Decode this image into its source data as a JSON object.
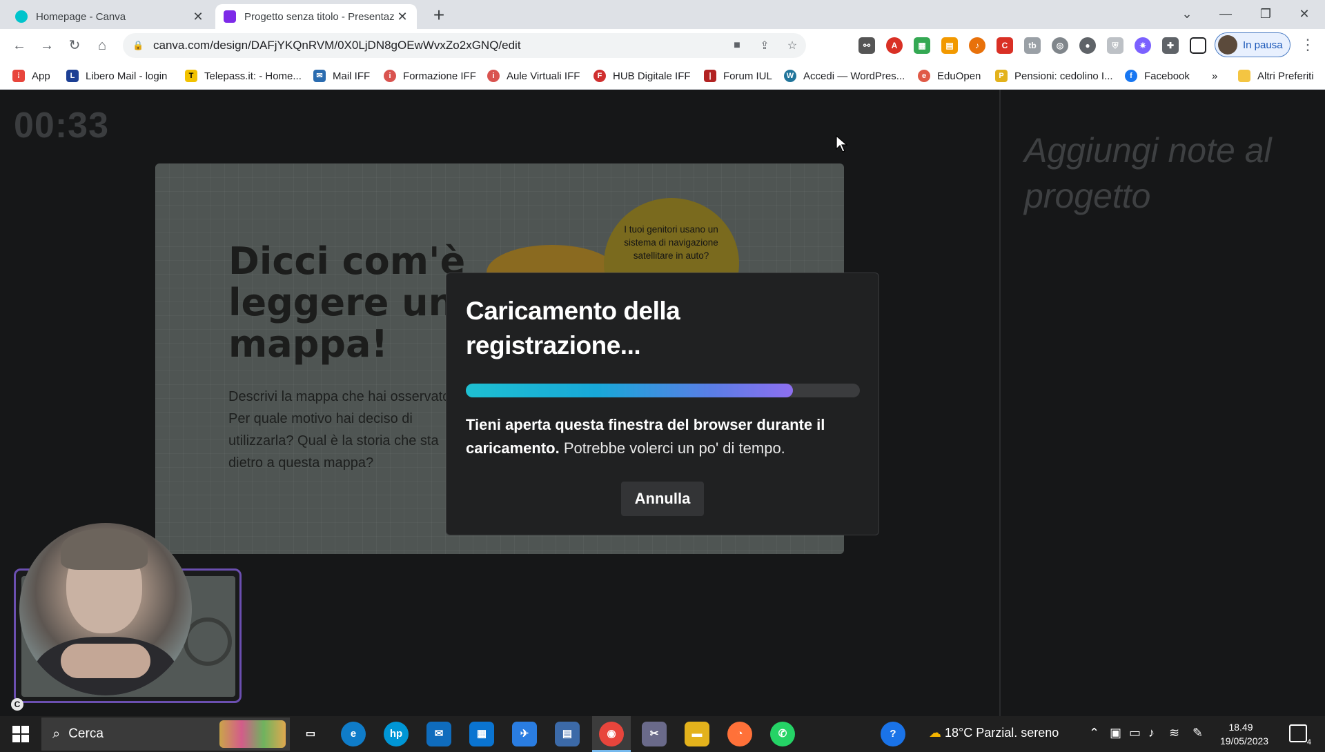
{
  "browser": {
    "tabs": [
      {
        "title": "Homepage - Canva",
        "active": false,
        "icon": "canva-icon"
      },
      {
        "title": "Progetto senza titolo - Presentaz",
        "active": true,
        "icon": "canva-present-icon"
      }
    ],
    "new_tab_label": "+",
    "url": "canva.com/design/DAFjYKQnRVM/0X0LjDN8gOEwWvxZo2xGNQ/edit",
    "profile_label": "In pausa",
    "window_controls": [
      "—",
      "❐",
      "✕"
    ],
    "tab_search": "⌄"
  },
  "bookmarks": {
    "items": [
      {
        "label": "App",
        "icon": "apps-grid-icon",
        "color": "#e8453c"
      },
      {
        "label": "Libero Mail - login",
        "icon": "libero-icon",
        "color": "#1c3f94"
      },
      {
        "label": "Telepass.it: - Home...",
        "icon": "telepass-icon",
        "color": "#f2c200"
      },
      {
        "label": "Mail IFF",
        "icon": "mail-icon",
        "color": "#2b6cb0"
      },
      {
        "label": "Formazione IFF",
        "icon": "iff-icon",
        "color": "#d9534f"
      },
      {
        "label": "Aule Virtuali IFF",
        "icon": "iff-icon",
        "color": "#d9534f"
      },
      {
        "label": "HUB Digitale IFF",
        "icon": "hub-icon",
        "color": "#d02f2f"
      },
      {
        "label": "Forum IUL",
        "icon": "iul-icon",
        "color": "#b22222"
      },
      {
        "label": "Accedi — WordPres...",
        "icon": "wordpress-icon",
        "color": "#21759b"
      },
      {
        "label": "EduOpen",
        "icon": "eduopen-icon",
        "color": "#e05a47"
      },
      {
        "label": "Pensioni: cedolino I...",
        "icon": "inps-icon",
        "color": "#e3b21c"
      },
      {
        "label": "Facebook",
        "icon": "facebook-icon",
        "color": "#1877f2"
      }
    ],
    "overflow_label": "»",
    "other_label": "Altri Preferiti"
  },
  "presenter": {
    "timer": "00:33",
    "notes_placeholder": "Aggiungi note al progetto"
  },
  "slide": {
    "title": "Dicci com'è leggere una mappa!",
    "body": "Descrivi la mappa che hai osservato. Per quale motivo hai deciso di utilizzarla? Qual è la storia che sta dietro a questa mappa?",
    "bubble": "I tuoi genitori usano un sistema di navigazione satellitare in auto?"
  },
  "modal": {
    "title": "Caricamento della registrazione...",
    "progress": 0.83,
    "message_bold": "Tieni aperta questa finestra del browser durante il caricamento.",
    "message_rest": " Potrebbe volerci un po' di tempo.",
    "cancel_label": "Annulla"
  },
  "taskbar": {
    "search_placeholder": "Cerca",
    "apps": [
      {
        "name": "task-view",
        "color": "#202020",
        "glyph": "▭"
      },
      {
        "name": "edge",
        "color": "#0f7cc9",
        "glyph": "e"
      },
      {
        "name": "hp",
        "color": "#0096d6",
        "glyph": "hp"
      },
      {
        "name": "mail",
        "color": "#0f6cbd",
        "glyph": "✉"
      },
      {
        "name": "store",
        "color": "#0a74d1",
        "glyph": "▦"
      },
      {
        "name": "app-blue",
        "color": "#2a7de1",
        "glyph": "✈"
      },
      {
        "name": "calculator",
        "color": "#3c6aa8",
        "glyph": "▤"
      },
      {
        "name": "chrome",
        "color": "#e8453c",
        "glyph": "◉"
      },
      {
        "name": "snip",
        "color": "#6a6a8a",
        "glyph": "✂"
      },
      {
        "name": "explorer",
        "color": "#e3b21c",
        "glyph": "▬"
      },
      {
        "name": "firefox",
        "color": "#ff7139",
        "glyph": "◔"
      },
      {
        "name": "whatsapp",
        "color": "#25d366",
        "glyph": "✆"
      }
    ],
    "weather": "18°C  Parzial. sereno",
    "time": "18.49",
    "date": "19/05/2023",
    "notification_count": "4"
  }
}
